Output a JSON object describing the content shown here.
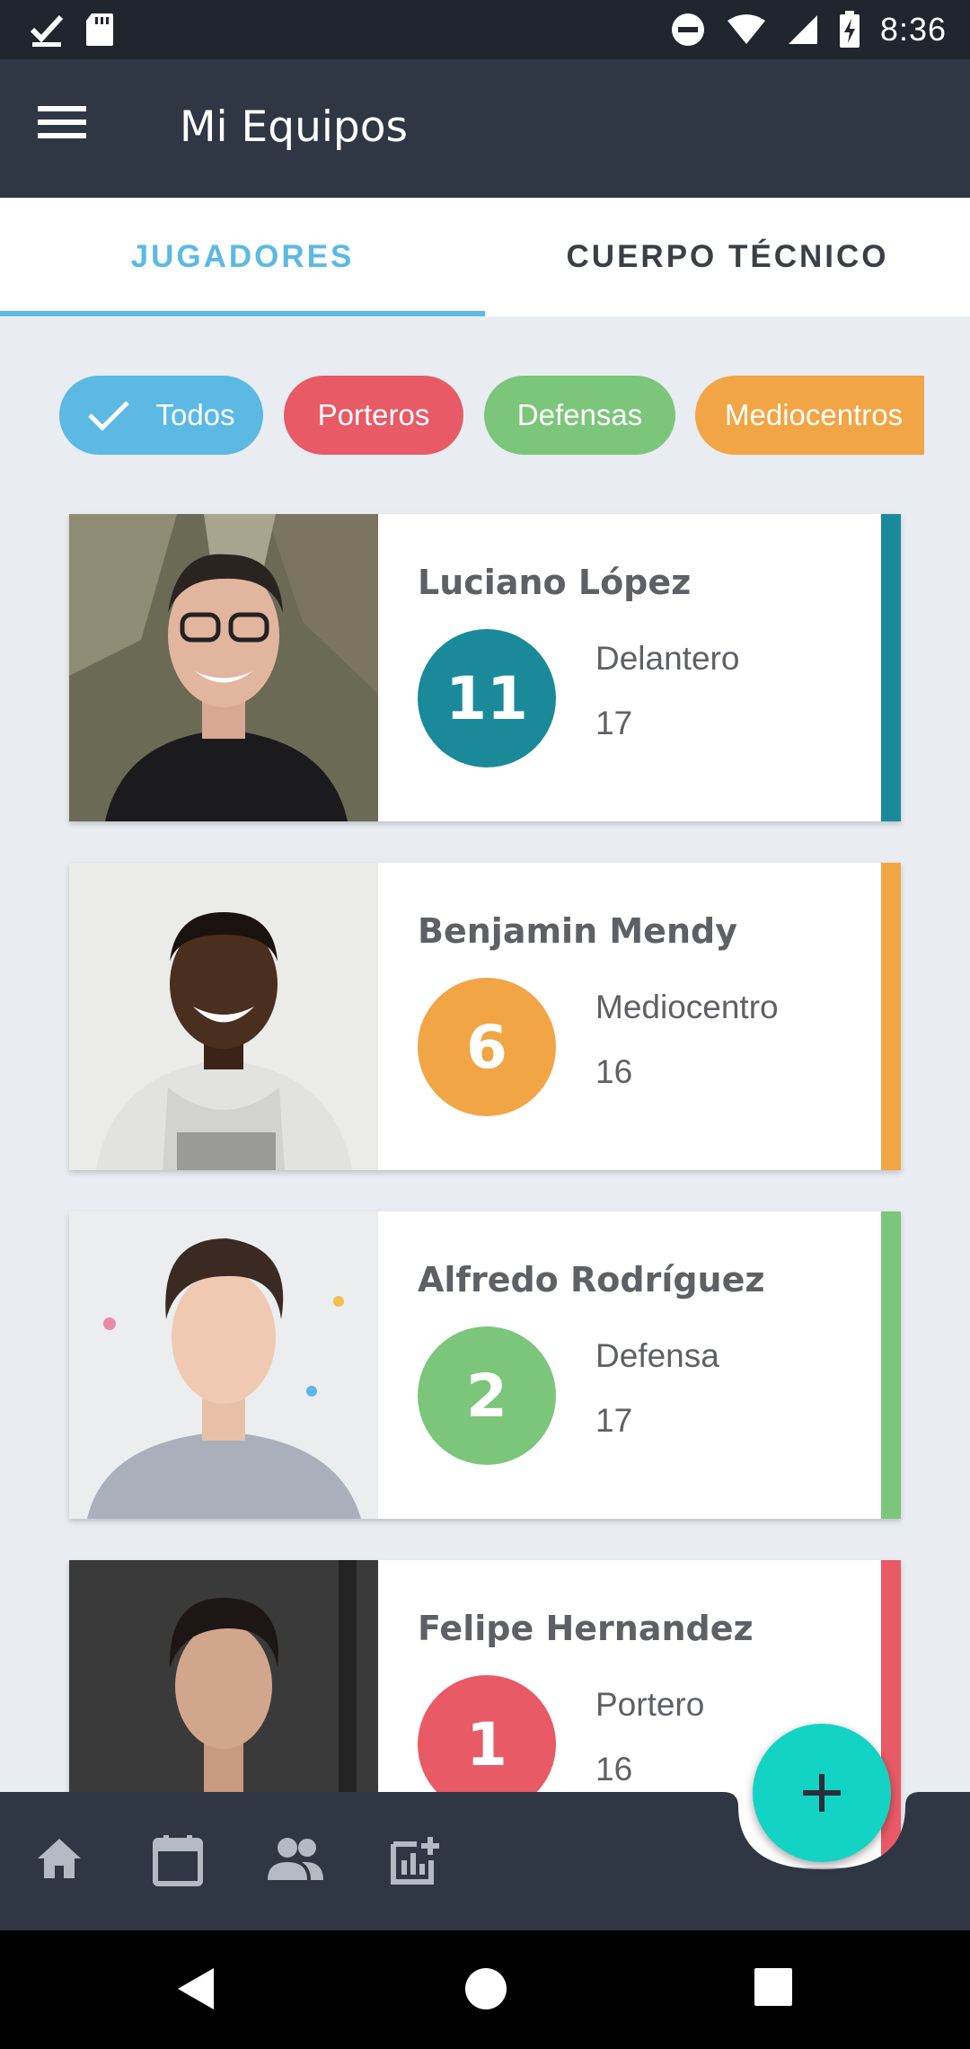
{
  "status_bar": {
    "time": "8:36"
  },
  "app_bar": {
    "title": "Mi Equipos"
  },
  "tabs": [
    {
      "label": "JUGADORES",
      "active": true
    },
    {
      "label": "CUERPO TÉCNICO",
      "active": false
    }
  ],
  "filters": [
    {
      "label": "Todos",
      "color": "#5BB9E4",
      "selected": true
    },
    {
      "label": "Porteros",
      "color": "#E85A66",
      "selected": false
    },
    {
      "label": "Defensas",
      "color": "#7BC67B",
      "selected": false
    },
    {
      "label": "Mediocentros",
      "color": "#F2A544",
      "selected": false
    }
  ],
  "players": [
    {
      "name": "Luciano López",
      "number": "11",
      "position": "Delantero",
      "age": "17",
      "color": "#1A8A9A"
    },
    {
      "name": "Benjamin Mendy",
      "number": "6",
      "position": "Mediocentro",
      "age": "16",
      "color": "#F2A544"
    },
    {
      "name": "Alfredo Rodríguez",
      "number": "2",
      "position": "Defensa",
      "age": "17",
      "color": "#7BC67B"
    },
    {
      "name": "Felipe Hernandez",
      "number": "1",
      "position": "Portero",
      "age": "16",
      "color": "#E85A66"
    }
  ],
  "bottom_nav": {
    "icons": [
      "home-icon",
      "calendar-icon",
      "people-icon",
      "stats-add-icon"
    ],
    "fab_icon": "plus-icon"
  },
  "colors": {
    "status_bar": "#20252E",
    "app_bar": "#2F3745",
    "accent": "#5BB9E4",
    "fab": "#13D3C4",
    "background": "#E9EDF2"
  }
}
